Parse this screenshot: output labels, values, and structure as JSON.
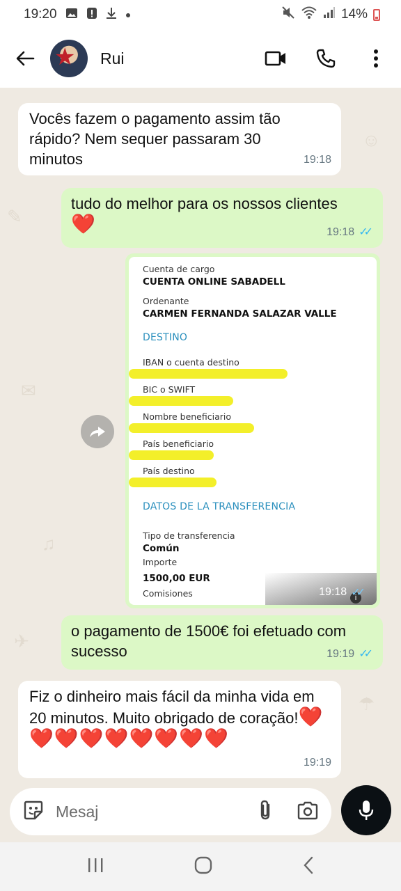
{
  "status": {
    "time": "19:20",
    "battery": "14%",
    "icons": [
      "image-icon",
      "alert-icon",
      "download-icon",
      "dot-icon",
      "mute-icon",
      "wifi-icon",
      "signal-icon",
      "battery-icon"
    ]
  },
  "header": {
    "contact_name": "Rui",
    "icons": [
      "back-arrow-icon",
      "video-call-icon",
      "phone-icon",
      "more-vert-icon"
    ]
  },
  "messages": [
    {
      "dir": "in",
      "text": "Vocês fazem o pagamento assim tão rápido? Nem sequer passaram 30 minutos",
      "time": "19:18"
    },
    {
      "dir": "out",
      "text": "tudo do melhor para os nossos clientes",
      "emoji": "❤️",
      "time": "19:18",
      "read": true
    },
    {
      "dir": "out",
      "type": "image",
      "time": "19:18",
      "read": true
    },
    {
      "dir": "out",
      "text": "o pagamento de 1500€ foi efetuado com sucesso",
      "time": "19:19",
      "read": true
    },
    {
      "dir": "in",
      "text": "Fiz o dinheiro mais fácil da minha vida em 20 minutos. Muito obrigado de coração!",
      "emoji": "❤️❤️❤️❤️❤️❤️❤️❤️❤️",
      "time": "19:19"
    }
  ],
  "transfer_image": {
    "cuenta_cargo_label": "Cuenta de cargo",
    "cuenta_cargo_value": "CUENTA ONLINE SABADELL",
    "ordenante_label": "Ordenante",
    "ordenante_value": "CARMEN FERNANDA SALAZAR VALLE",
    "destino_heading": "DESTINO",
    "iban_label": "IBAN o cuenta destino",
    "bic_label": "BIC o SWIFT",
    "beneficiario_label": "Nombre beneficiario",
    "pais_beneficiario_label": "País beneficiario",
    "pais_destino_label": "País destino",
    "datos_heading": "DATOS DE LA TRANSFERENCIA",
    "tipo_label": "Tipo de transferencia",
    "tipo_value": "Común",
    "importe_label": "Importe",
    "importe_value": "1500,00 EUR",
    "comisiones_label": "Comisiones",
    "highlight_color": "#f3ef2a"
  },
  "composer": {
    "placeholder": "Mesaj",
    "icons": [
      "sticker-icon",
      "attach-icon",
      "camera-icon",
      "mic-icon"
    ]
  },
  "colors": {
    "chat_bg": "#efeae2",
    "incoming_bubble": "#ffffff",
    "outgoing_bubble": "#dcf8c6",
    "read_ticks": "#34b7f1",
    "section_blue": "#2a8fbd"
  }
}
